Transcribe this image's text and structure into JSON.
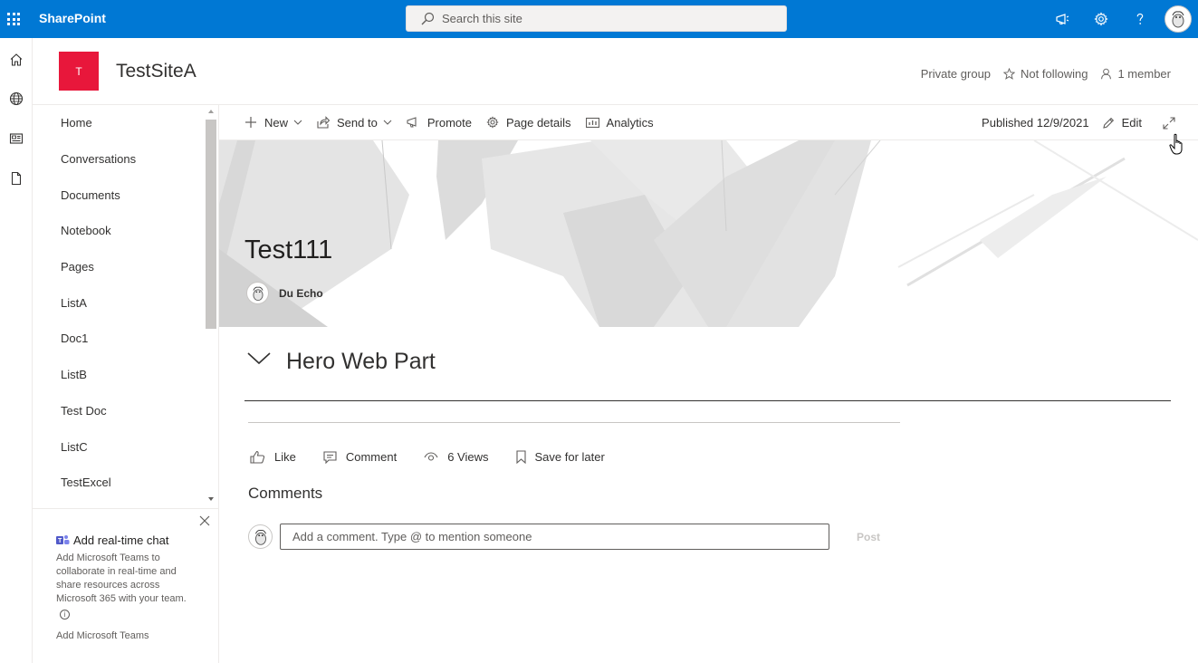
{
  "suitebar": {
    "brand": "SharePoint",
    "search_placeholder": "Search this site",
    "icons": [
      "waffle-icon",
      "megaphone-icon",
      "gear-icon",
      "help-icon"
    ]
  },
  "appbar": {
    "icons": [
      "home-icon",
      "globe-icon",
      "news-icon",
      "document-icon"
    ]
  },
  "site": {
    "logo_letter": "T",
    "title": "TestSiteA",
    "privacy": "Private group",
    "follow": "Not following",
    "members": "1 member"
  },
  "nav": {
    "items": [
      "Home",
      "Conversations",
      "Documents",
      "Notebook",
      "Pages",
      "ListA",
      "Doc1",
      "ListB",
      "Test Doc",
      "ListC",
      "TestExcel"
    ]
  },
  "teams_promo": {
    "title": "Add real-time chat",
    "description": "Add Microsoft Teams to collaborate in real-time and share resources across Microsoft 365 with your team.",
    "info": "i",
    "link": "Add Microsoft Teams"
  },
  "commandbar": {
    "new": "New",
    "send_to": "Send to",
    "promote": "Promote",
    "page_details": "Page details",
    "analytics": "Analytics",
    "published": "Published 12/9/2021",
    "edit": "Edit"
  },
  "page": {
    "title": "Test111",
    "author": "Du Echo",
    "section_title": "Hero Web Part"
  },
  "social": {
    "like": "Like",
    "comment": "Comment",
    "views": "6 Views",
    "save": "Save for later"
  },
  "comments": {
    "title": "Comments",
    "placeholder": "Add a comment. Type @ to mention someone",
    "post": "Post"
  },
  "colors": {
    "suitebar": "#0078d4",
    "site_logo": "#e8173b"
  }
}
